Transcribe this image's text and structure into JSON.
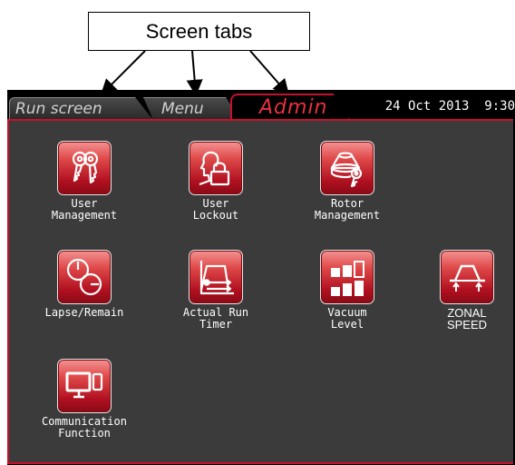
{
  "annotation": {
    "callout_label": "Screen tabs"
  },
  "tabs": [
    {
      "label": "Run screen",
      "active": false
    },
    {
      "label": "Menu",
      "active": false
    },
    {
      "label": "Admin",
      "active": true
    }
  ],
  "status": {
    "date": "24 Oct 2013",
    "time": "9:30"
  },
  "theme": {
    "accent": "#c8102e",
    "panel": "#3b3b3b",
    "icon_red": "#c8102e"
  },
  "items": [
    {
      "label": "User\nManagement",
      "icon": "keys-icon"
    },
    {
      "label": "User\nLockout",
      "icon": "user-lock-icon"
    },
    {
      "label": "Rotor\nManagement",
      "icon": "rotor-key-icon"
    },
    {
      "label": "Lapse/Remain",
      "icon": "clocks-icon"
    },
    {
      "label": "Actual Run\nTimer",
      "icon": "run-timer-graph-icon"
    },
    {
      "label": "Vacuum\nLevel",
      "icon": "vacuum-bars-icon"
    },
    {
      "label": "ZONAL\nSPEED",
      "icon": "zonal-speed-icon"
    },
    {
      "label": "Communication\nFunction",
      "icon": "computer-phone-icon"
    }
  ]
}
